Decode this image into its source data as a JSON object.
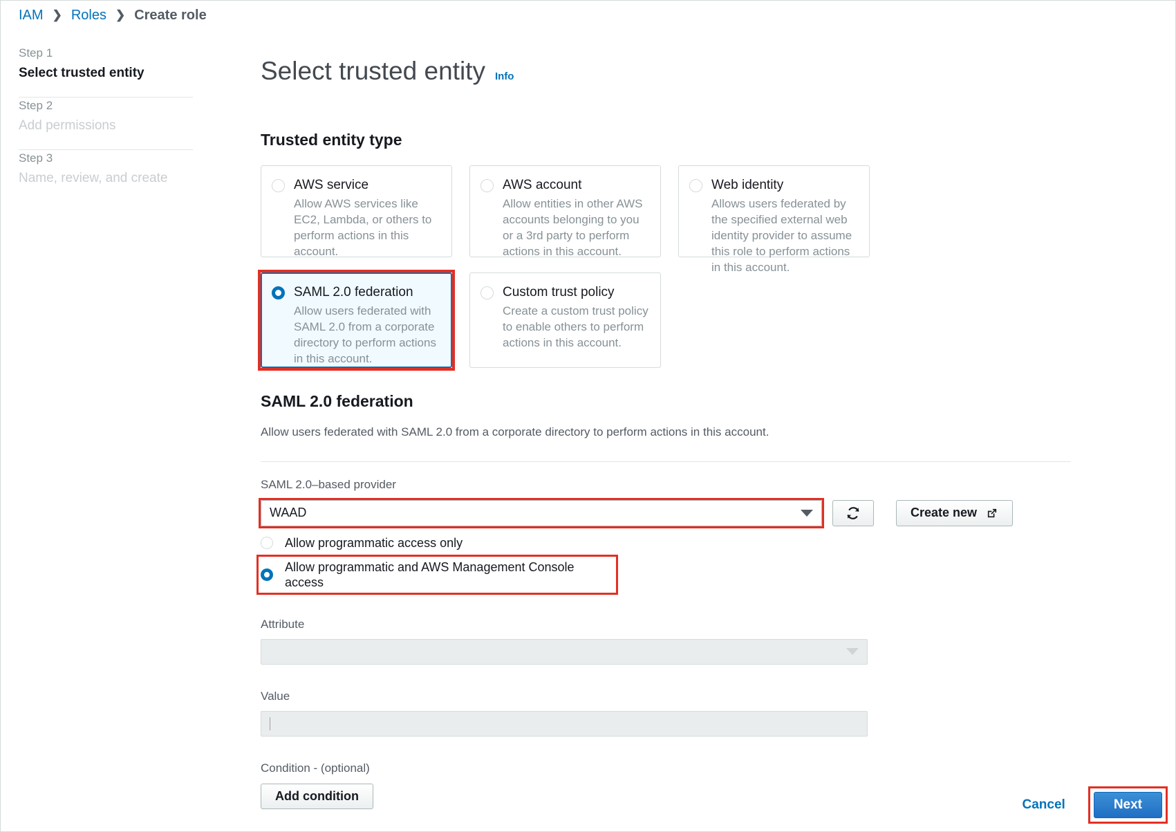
{
  "breadcrumb": {
    "items": [
      {
        "label": "IAM",
        "current": false
      },
      {
        "label": "Roles",
        "current": false
      },
      {
        "label": "Create role",
        "current": true
      }
    ],
    "separator": "❯"
  },
  "steps": [
    {
      "number": "Step 1",
      "name": "Select trusted entity",
      "state": "active"
    },
    {
      "number": "Step 2",
      "name": "Add permissions",
      "state": "inactive"
    },
    {
      "number": "Step 3",
      "name": "Name, review, and create",
      "state": "inactive"
    }
  ],
  "main": {
    "title": "Select trusted entity",
    "info_label": "Info",
    "section_heading": "Trusted entity type",
    "tiles": [
      {
        "title": "AWS service",
        "description": "Allow AWS services like EC2, Lambda, or others to perform actions in this account.",
        "selected": false,
        "highlighted": false
      },
      {
        "title": "AWS account",
        "description": "Allow entities in other AWS accounts belonging to you or a 3rd party to perform actions in this account.",
        "selected": false,
        "highlighted": false
      },
      {
        "title": "Web identity",
        "description": "Allows users federated by the specified external web identity provider to assume this role to perform actions in this account.",
        "selected": false,
        "highlighted": false
      },
      {
        "title": "SAML 2.0 federation",
        "description": "Allow users federated with SAML 2.0 from a corporate directory to perform actions in this account.",
        "selected": true,
        "highlighted": true
      },
      {
        "title": "Custom trust policy",
        "description": "Create a custom trust policy to enable others to perform actions in this account.",
        "selected": false,
        "highlighted": false
      }
    ]
  },
  "federation": {
    "heading": "SAML 2.0 federation",
    "description": "Allow users federated with SAML 2.0 from a corporate directory to perform actions in this account.",
    "provider_label": "SAML 2.0–based provider",
    "provider_value": "WAAD",
    "refresh_icon": "refresh-icon",
    "create_new_label": "Create new",
    "create_new_icon": "external-link-icon",
    "access_options": [
      {
        "label": "Allow programmatic access only",
        "selected": false,
        "highlighted": false
      },
      {
        "label": "Allow programmatic and AWS Management Console access",
        "selected": true,
        "highlighted": true
      }
    ],
    "attribute_label": "Attribute",
    "attribute_value": "",
    "value_label": "Value",
    "value_text": "",
    "condition_label": "Condition - (optional)",
    "add_condition_label": "Add condition"
  },
  "footer": {
    "cancel_label": "Cancel",
    "next_label": "Next"
  },
  "colors": {
    "link": "#0073bb",
    "selected_border": "#0073bb",
    "selected_fill": "#f1faff",
    "highlight": "#e32f23",
    "primary_button": "#2a74c6"
  }
}
